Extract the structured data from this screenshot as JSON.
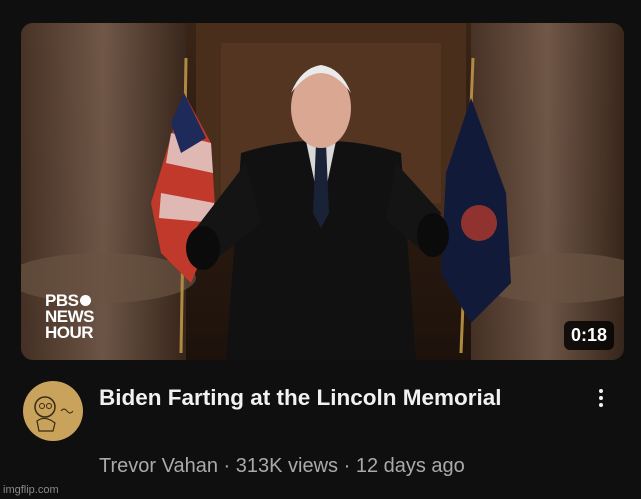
{
  "video": {
    "duration": "0:18",
    "logo_line1": "PBS",
    "logo_line2": "NEWS",
    "logo_line3": "HOUR",
    "title": "Biden Farting at the Lincoln Memorial",
    "channel": "Trevor Vahan",
    "views": "313K views",
    "age": "12 days ago",
    "separator": "·"
  },
  "watermark": "imgflip.com",
  "icons": {
    "more": "more-vert-icon",
    "avatar": "channel-avatar"
  },
  "colors": {
    "background": "#0f0f0f",
    "title": "#f1f1f1",
    "meta": "#aaaaaa"
  }
}
